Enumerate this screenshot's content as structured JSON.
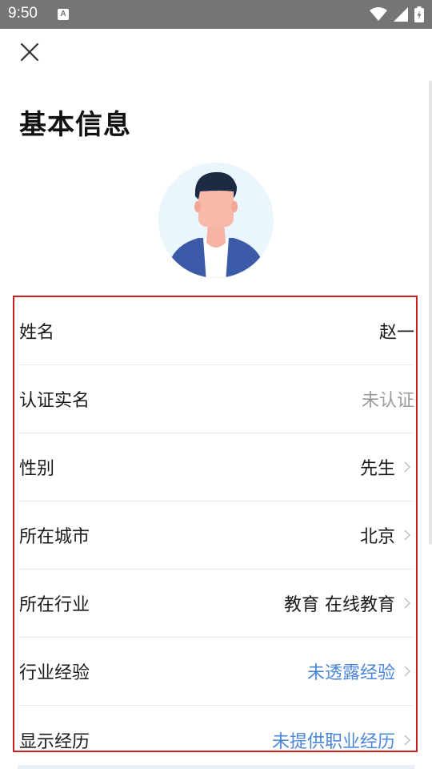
{
  "status_bar": {
    "time": "9:50",
    "notification_icon": "A"
  },
  "header": {
    "title": "基本信息"
  },
  "rows": [
    {
      "label": "姓名",
      "value": "赵一"
    },
    {
      "label": "认证实名",
      "value": "未认证"
    },
    {
      "label": "性别",
      "value": "先生"
    },
    {
      "label": "所在城市",
      "value": "北京"
    },
    {
      "label": "所在行业",
      "value": "教育 在线教育"
    },
    {
      "label": "行业经验",
      "value": "未透露经验"
    },
    {
      "label": "显示经历",
      "value": "未提供职业经历"
    }
  ],
  "colors": {
    "status_bar_bg": "#757575",
    "highlight_border": "#cc1f1f",
    "link_blue": "#4a86d9",
    "muted_gray": "#9a9a9a"
  }
}
